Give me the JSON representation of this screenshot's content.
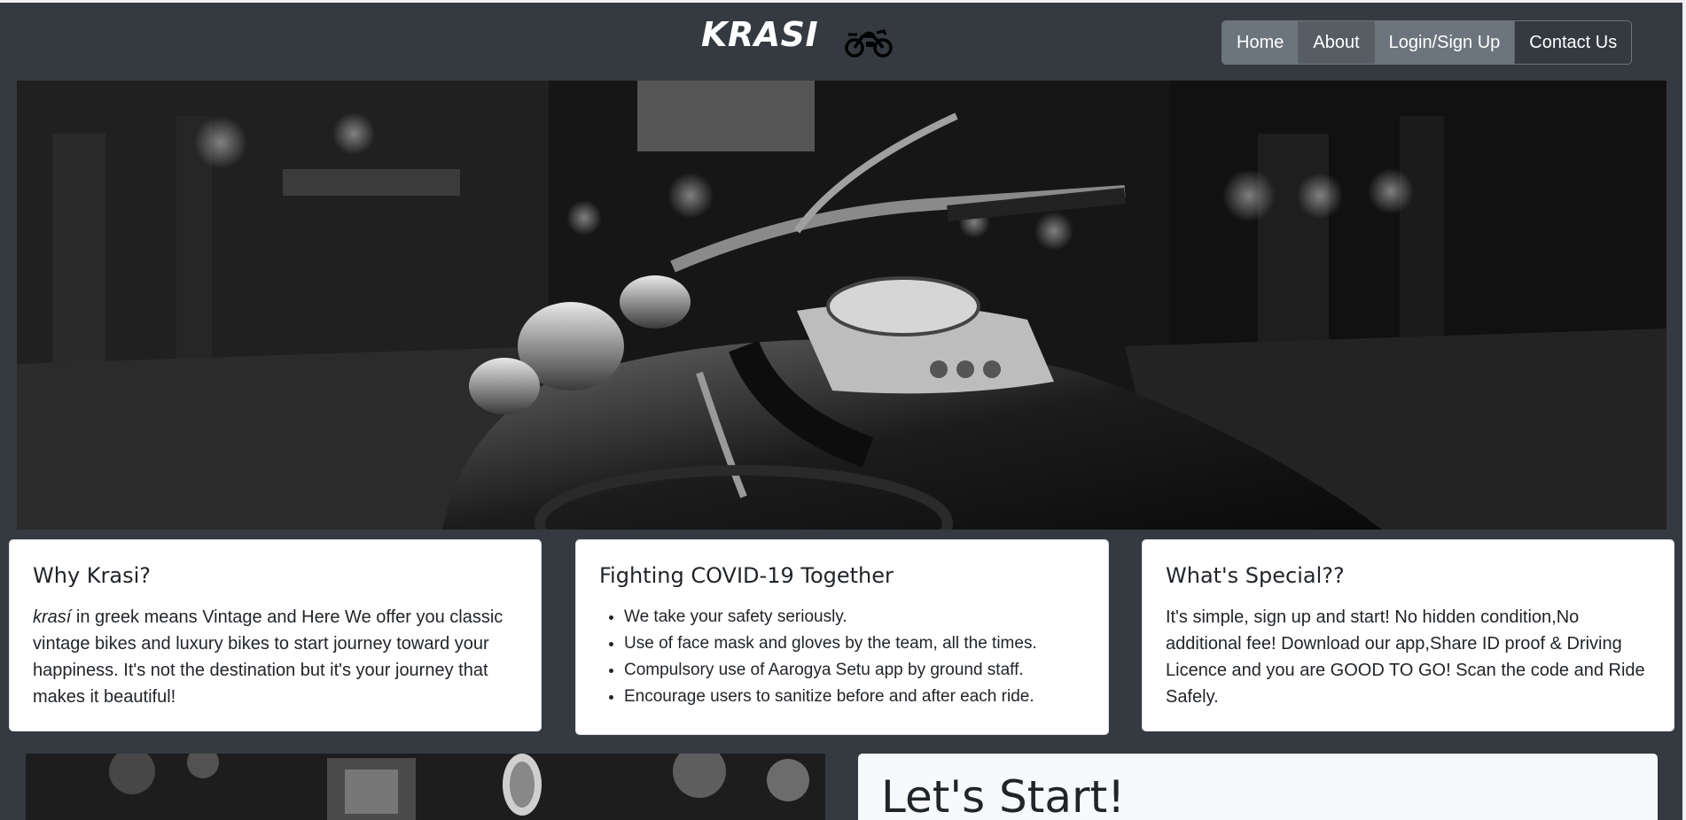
{
  "header": {
    "brand": "KRASI",
    "logo_icon": "motorbike-icon",
    "nav": [
      {
        "label": "Home"
      },
      {
        "label": "About"
      },
      {
        "label": "Login/Sign Up"
      },
      {
        "label": "Contact Us"
      }
    ]
  },
  "hero": {
    "image": "black-and-white motorcycle photo"
  },
  "cards": {
    "why": {
      "title": "Why Krasi?",
      "italic_word": "krasí",
      "body": " in greek means Vintage and Here We offer you classic vintage bikes and luxury bikes to start journey toward your happiness. It's not the destination but it's your journey that makes it beautiful!"
    },
    "covid": {
      "title": "Fighting COVID-19 Together",
      "items": [
        "We take your safety seriously.",
        "Use of face mask and gloves by the team, all the times.",
        "Compulsory use of Aarogya Setu app by ground staff.",
        "Encourage users to sanitize before and after each ride."
      ]
    },
    "special": {
      "title": "What's Special??",
      "body": "It's simple, sign up and start! No hidden condition,No additional fee! Download our app,Share ID proof & Driving Licence and you are GOOD TO GO! Scan the code and Ride Safely."
    }
  },
  "start": {
    "title": "Let's Start!"
  },
  "colors": {
    "background": "#343a40",
    "nav_active": "#6c757d",
    "card": "#ffffff"
  }
}
